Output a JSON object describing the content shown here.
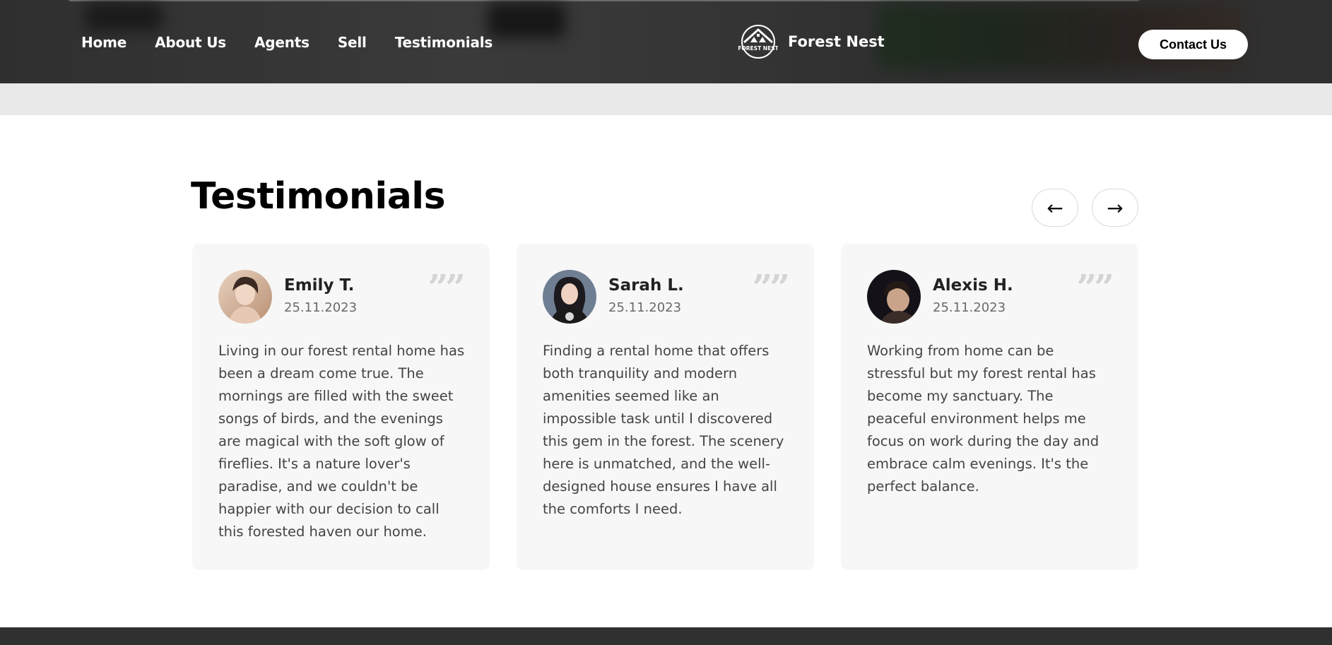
{
  "header": {
    "nav": [
      "Home",
      "About Us",
      "Agents",
      "Sell",
      "Testimonials"
    ],
    "brand_name": "Forest Nest",
    "logo_text": "FOREST NEST",
    "contact_label": "Contact Us"
  },
  "testimonials": {
    "title": "Testimonials",
    "prev_label": "←",
    "next_label": "→",
    "quote_mark": "””",
    "cards": [
      {
        "name": "Emily T.",
        "date": "25.11.2023",
        "text": "Living in our forest rental home has been a dream come true. The mornings are filled with the sweet songs of birds, and the evenings are magical with the soft glow of fireflies. It's a nature lover's paradise, and we couldn't be happier with our decision to call this forested haven our home."
      },
      {
        "name": "Sarah L.",
        "date": "25.11.2023",
        "text": "Finding a rental home that offers both tranquility and modern amenities seemed like an impossible task until I discovered this gem in the forest. The scenery here is unmatched, and the well-designed house ensures I have all the comforts I need."
      },
      {
        "name": "Alexis H.",
        "date": "25.11.2023",
        "text": "Working from home can be stressful but my forest rental has become my sanctuary. The peaceful environment helps me focus on work during the day and embrace calm evenings. It's the perfect balance."
      }
    ]
  },
  "colors": {
    "header_bg": "#333333",
    "card_bg": "#f7f7f7",
    "band_grey": "#e9e9e9",
    "footer_bg": "#303030"
  }
}
